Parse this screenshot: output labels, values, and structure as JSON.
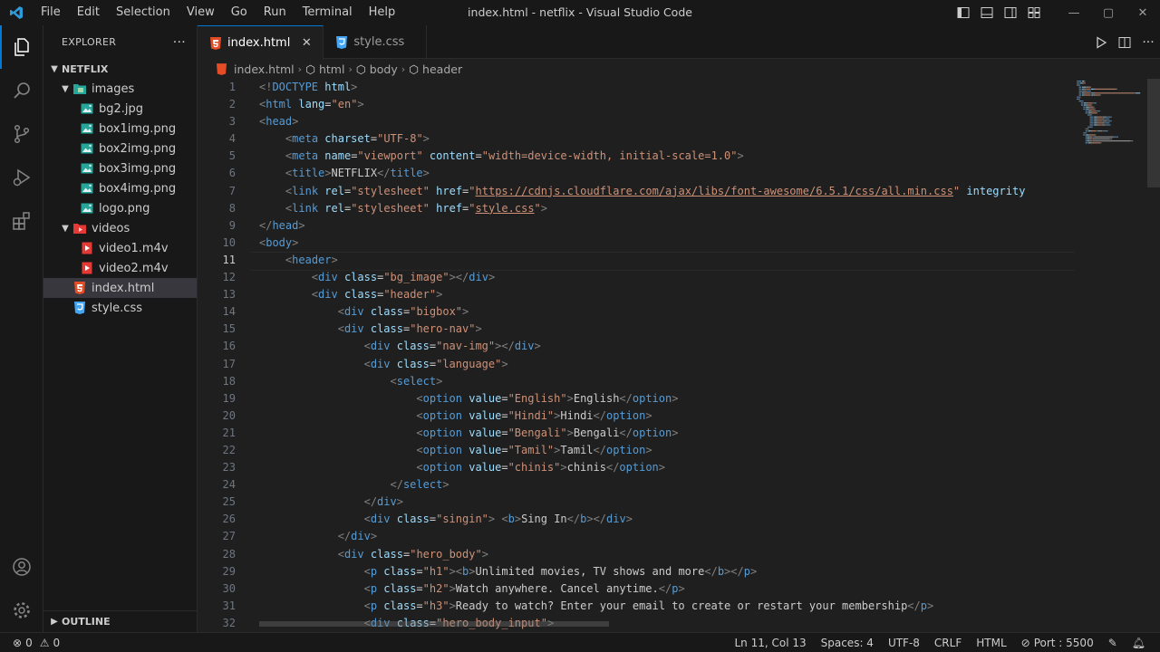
{
  "window": {
    "title": "index.html - netflix - Visual Studio Code"
  },
  "menu": [
    "File",
    "Edit",
    "Selection",
    "View",
    "Go",
    "Run",
    "Terminal",
    "Help"
  ],
  "sidebar": {
    "title": "EXPLORER",
    "more": "···",
    "root": "NETFLIX",
    "tree": [
      {
        "label": "images",
        "kind": "folder",
        "depth": 1
      },
      {
        "label": "bg2.jpg",
        "kind": "image",
        "depth": 2
      },
      {
        "label": "box1img.png",
        "kind": "image",
        "depth": 2
      },
      {
        "label": "box2img.png",
        "kind": "image",
        "depth": 2
      },
      {
        "label": "box3img.png",
        "kind": "image",
        "depth": 2
      },
      {
        "label": "box4img.png",
        "kind": "image",
        "depth": 2
      },
      {
        "label": "logo.png",
        "kind": "image",
        "depth": 2
      },
      {
        "label": "videos",
        "kind": "folder-video",
        "depth": 1
      },
      {
        "label": "video1.m4v",
        "kind": "video",
        "depth": 2
      },
      {
        "label": "video2.m4v",
        "kind": "video",
        "depth": 2
      },
      {
        "label": "index.html",
        "kind": "html",
        "depth": 1,
        "selected": true
      },
      {
        "label": "style.css",
        "kind": "css",
        "depth": 1
      }
    ],
    "outline": "OUTLINE"
  },
  "tabs": [
    {
      "label": "index.html",
      "active": true,
      "close": "✕"
    },
    {
      "label": "style.css",
      "active": false
    }
  ],
  "breadcrumb": [
    "index.html",
    "html",
    "body",
    "header"
  ],
  "editor": {
    "current_line": 11,
    "lines": [
      [
        [
          "tb",
          "<!"
        ],
        [
          "tg",
          "DOCTYPE"
        ],
        [
          "tx",
          " "
        ],
        [
          "at",
          "html"
        ],
        [
          "tb",
          ">"
        ]
      ],
      [
        [
          "tb",
          "<"
        ],
        [
          "tg",
          "html"
        ],
        [
          "tx",
          " "
        ],
        [
          "at",
          "lang"
        ],
        [
          "tx",
          "="
        ],
        [
          "vl",
          "\"en\""
        ],
        [
          "tb",
          ">"
        ]
      ],
      [
        [
          "tb",
          "<"
        ],
        [
          "tg",
          "head"
        ],
        [
          "tb",
          ">"
        ]
      ],
      [
        [
          "tx",
          "    "
        ],
        [
          "tb",
          "<"
        ],
        [
          "tg",
          "meta"
        ],
        [
          "tx",
          " "
        ],
        [
          "at",
          "charset"
        ],
        [
          "tx",
          "="
        ],
        [
          "vl",
          "\"UTF-8\""
        ],
        [
          "tb",
          ">"
        ]
      ],
      [
        [
          "tx",
          "    "
        ],
        [
          "tb",
          "<"
        ],
        [
          "tg",
          "meta"
        ],
        [
          "tx",
          " "
        ],
        [
          "at",
          "name"
        ],
        [
          "tx",
          "="
        ],
        [
          "vl",
          "\"viewport\""
        ],
        [
          "tx",
          " "
        ],
        [
          "at",
          "content"
        ],
        [
          "tx",
          "="
        ],
        [
          "vl",
          "\"width=device-width, initial-scale=1.0\""
        ],
        [
          "tb",
          ">"
        ]
      ],
      [
        [
          "tx",
          "    "
        ],
        [
          "tb",
          "<"
        ],
        [
          "tg",
          "title"
        ],
        [
          "tb",
          ">"
        ],
        [
          "tx",
          "NETFLIX"
        ],
        [
          "tb",
          "</"
        ],
        [
          "tg",
          "title"
        ],
        [
          "tb",
          ">"
        ]
      ],
      [
        [
          "tx",
          "    "
        ],
        [
          "tb",
          "<"
        ],
        [
          "tg",
          "link"
        ],
        [
          "tx",
          " "
        ],
        [
          "at",
          "rel"
        ],
        [
          "tx",
          "="
        ],
        [
          "vl",
          "\"stylesheet\""
        ],
        [
          "tx",
          " "
        ],
        [
          "at",
          "href"
        ],
        [
          "tx",
          "="
        ],
        [
          "vl",
          "\""
        ],
        [
          "lu",
          "https://cdnjs.cloudflare.com/ajax/libs/font-awesome/6.5.1/css/all.min.css"
        ],
        [
          "vl",
          "\""
        ],
        [
          "tx",
          " "
        ],
        [
          "at",
          "integrity"
        ]
      ],
      [
        [
          "tx",
          "    "
        ],
        [
          "tb",
          "<"
        ],
        [
          "tg",
          "link"
        ],
        [
          "tx",
          " "
        ],
        [
          "at",
          "rel"
        ],
        [
          "tx",
          "="
        ],
        [
          "vl",
          "\"stylesheet\""
        ],
        [
          "tx",
          " "
        ],
        [
          "at",
          "href"
        ],
        [
          "tx",
          "="
        ],
        [
          "vl",
          "\""
        ],
        [
          "lu",
          "style.css"
        ],
        [
          "vl",
          "\""
        ],
        [
          "tb",
          ">"
        ]
      ],
      [
        [
          "tb",
          "</"
        ],
        [
          "tg",
          "head"
        ],
        [
          "tb",
          ">"
        ]
      ],
      [
        [
          "tb",
          "<"
        ],
        [
          "tg",
          "body"
        ],
        [
          "tb",
          ">"
        ]
      ],
      [
        [
          "tx",
          "    "
        ],
        [
          "tb",
          "<"
        ],
        [
          "tg",
          "header"
        ],
        [
          "tb",
          ">"
        ]
      ],
      [
        [
          "tx",
          "        "
        ],
        [
          "tb",
          "<"
        ],
        [
          "tg",
          "div"
        ],
        [
          "tx",
          " "
        ],
        [
          "at",
          "class"
        ],
        [
          "tx",
          "="
        ],
        [
          "vl",
          "\"bg_image\""
        ],
        [
          "tb",
          "></"
        ],
        [
          "tg",
          "div"
        ],
        [
          "tb",
          ">"
        ]
      ],
      [
        [
          "tx",
          "        "
        ],
        [
          "tb",
          "<"
        ],
        [
          "tg",
          "div"
        ],
        [
          "tx",
          " "
        ],
        [
          "at",
          "class"
        ],
        [
          "tx",
          "="
        ],
        [
          "vl",
          "\"header\""
        ],
        [
          "tb",
          ">"
        ]
      ],
      [
        [
          "tx",
          "            "
        ],
        [
          "tb",
          "<"
        ],
        [
          "tg",
          "div"
        ],
        [
          "tx",
          " "
        ],
        [
          "at",
          "class"
        ],
        [
          "tx",
          "="
        ],
        [
          "vl",
          "\"bigbox\""
        ],
        [
          "tb",
          ">"
        ]
      ],
      [
        [
          "tx",
          "            "
        ],
        [
          "tb",
          "<"
        ],
        [
          "tg",
          "div"
        ],
        [
          "tx",
          " "
        ],
        [
          "at",
          "class"
        ],
        [
          "tx",
          "="
        ],
        [
          "vl",
          "\"hero-nav\""
        ],
        [
          "tb",
          ">"
        ]
      ],
      [
        [
          "tx",
          "                "
        ],
        [
          "tb",
          "<"
        ],
        [
          "tg",
          "div"
        ],
        [
          "tx",
          " "
        ],
        [
          "at",
          "class"
        ],
        [
          "tx",
          "="
        ],
        [
          "vl",
          "\"nav-img\""
        ],
        [
          "tb",
          "></"
        ],
        [
          "tg",
          "div"
        ],
        [
          "tb",
          ">"
        ]
      ],
      [
        [
          "tx",
          "                "
        ],
        [
          "tb",
          "<"
        ],
        [
          "tg",
          "div"
        ],
        [
          "tx",
          " "
        ],
        [
          "at",
          "class"
        ],
        [
          "tx",
          "="
        ],
        [
          "vl",
          "\"language\""
        ],
        [
          "tb",
          ">"
        ]
      ],
      [
        [
          "tx",
          "                    "
        ],
        [
          "tb",
          "<"
        ],
        [
          "tg",
          "select"
        ],
        [
          "tb",
          ">"
        ]
      ],
      [
        [
          "tx",
          "                        "
        ],
        [
          "tb",
          "<"
        ],
        [
          "tg",
          "option"
        ],
        [
          "tx",
          " "
        ],
        [
          "at",
          "value"
        ],
        [
          "tx",
          "="
        ],
        [
          "vl",
          "\"English\""
        ],
        [
          "tb",
          ">"
        ],
        [
          "tx",
          "English"
        ],
        [
          "tb",
          "</"
        ],
        [
          "tg",
          "option"
        ],
        [
          "tb",
          ">"
        ]
      ],
      [
        [
          "tx",
          "                        "
        ],
        [
          "tb",
          "<"
        ],
        [
          "tg",
          "option"
        ],
        [
          "tx",
          " "
        ],
        [
          "at",
          "value"
        ],
        [
          "tx",
          "="
        ],
        [
          "vl",
          "\"Hindi\""
        ],
        [
          "tb",
          ">"
        ],
        [
          "tx",
          "Hindi"
        ],
        [
          "tb",
          "</"
        ],
        [
          "tg",
          "option"
        ],
        [
          "tb",
          ">"
        ]
      ],
      [
        [
          "tx",
          "                        "
        ],
        [
          "tb",
          "<"
        ],
        [
          "tg",
          "option"
        ],
        [
          "tx",
          " "
        ],
        [
          "at",
          "value"
        ],
        [
          "tx",
          "="
        ],
        [
          "vl",
          "\"Bengali\""
        ],
        [
          "tb",
          ">"
        ],
        [
          "tx",
          "Bengali"
        ],
        [
          "tb",
          "</"
        ],
        [
          "tg",
          "option"
        ],
        [
          "tb",
          ">"
        ]
      ],
      [
        [
          "tx",
          "                        "
        ],
        [
          "tb",
          "<"
        ],
        [
          "tg",
          "option"
        ],
        [
          "tx",
          " "
        ],
        [
          "at",
          "value"
        ],
        [
          "tx",
          "="
        ],
        [
          "vl",
          "\"Tamil\""
        ],
        [
          "tb",
          ">"
        ],
        [
          "tx",
          "Tamil"
        ],
        [
          "tb",
          "</"
        ],
        [
          "tg",
          "option"
        ],
        [
          "tb",
          ">"
        ]
      ],
      [
        [
          "tx",
          "                        "
        ],
        [
          "tb",
          "<"
        ],
        [
          "tg",
          "option"
        ],
        [
          "tx",
          " "
        ],
        [
          "at",
          "value"
        ],
        [
          "tx",
          "="
        ],
        [
          "vl",
          "\"chinis\""
        ],
        [
          "tb",
          ">"
        ],
        [
          "tx",
          "chinis"
        ],
        [
          "tb",
          "</"
        ],
        [
          "tg",
          "option"
        ],
        [
          "tb",
          ">"
        ]
      ],
      [
        [
          "tx",
          "                    "
        ],
        [
          "tb",
          "</"
        ],
        [
          "tg",
          "select"
        ],
        [
          "tb",
          ">"
        ]
      ],
      [
        [
          "tx",
          "                "
        ],
        [
          "tb",
          "</"
        ],
        [
          "tg",
          "div"
        ],
        [
          "tb",
          ">"
        ]
      ],
      [
        [
          "tx",
          "                "
        ],
        [
          "tb",
          "<"
        ],
        [
          "tg",
          "div"
        ],
        [
          "tx",
          " "
        ],
        [
          "at",
          "class"
        ],
        [
          "tx",
          "="
        ],
        [
          "vl",
          "\"singin\""
        ],
        [
          "tb",
          ">"
        ],
        [
          "tx",
          " "
        ],
        [
          "tb",
          "<"
        ],
        [
          "tg",
          "b"
        ],
        [
          "tb",
          ">"
        ],
        [
          "tx",
          "Sing In"
        ],
        [
          "tb",
          "</"
        ],
        [
          "tg",
          "b"
        ],
        [
          "tb",
          "></"
        ],
        [
          "tg",
          "div"
        ],
        [
          "tb",
          ">"
        ]
      ],
      [
        [
          "tx",
          "            "
        ],
        [
          "tb",
          "</"
        ],
        [
          "tg",
          "div"
        ],
        [
          "tb",
          ">"
        ]
      ],
      [
        [
          "tx",
          "            "
        ],
        [
          "tb",
          "<"
        ],
        [
          "tg",
          "div"
        ],
        [
          "tx",
          " "
        ],
        [
          "at",
          "class"
        ],
        [
          "tx",
          "="
        ],
        [
          "vl",
          "\"hero_body\""
        ],
        [
          "tb",
          ">"
        ]
      ],
      [
        [
          "tx",
          "                "
        ],
        [
          "tb",
          "<"
        ],
        [
          "tg",
          "p"
        ],
        [
          "tx",
          " "
        ],
        [
          "at",
          "class"
        ],
        [
          "tx",
          "="
        ],
        [
          "vl",
          "\"h1\""
        ],
        [
          "tb",
          "><"
        ],
        [
          "tg",
          "b"
        ],
        [
          "tb",
          ">"
        ],
        [
          "tx",
          "Unlimited movies, TV shows and more"
        ],
        [
          "tb",
          "</"
        ],
        [
          "tg",
          "b"
        ],
        [
          "tb",
          "></"
        ],
        [
          "tg",
          "p"
        ],
        [
          "tb",
          ">"
        ]
      ],
      [
        [
          "tx",
          "                "
        ],
        [
          "tb",
          "<"
        ],
        [
          "tg",
          "p"
        ],
        [
          "tx",
          " "
        ],
        [
          "at",
          "class"
        ],
        [
          "tx",
          "="
        ],
        [
          "vl",
          "\"h2\""
        ],
        [
          "tb",
          ">"
        ],
        [
          "tx",
          "Watch anywhere. Cancel anytime."
        ],
        [
          "tb",
          "</"
        ],
        [
          "tg",
          "p"
        ],
        [
          "tb",
          ">"
        ]
      ],
      [
        [
          "tx",
          "                "
        ],
        [
          "tb",
          "<"
        ],
        [
          "tg",
          "p"
        ],
        [
          "tx",
          " "
        ],
        [
          "at",
          "class"
        ],
        [
          "tx",
          "="
        ],
        [
          "vl",
          "\"h3\""
        ],
        [
          "tb",
          ">"
        ],
        [
          "tx",
          "Ready to watch? Enter your email to create or restart your membership"
        ],
        [
          "tb",
          "</"
        ],
        [
          "tg",
          "p"
        ],
        [
          "tb",
          ">"
        ]
      ],
      [
        [
          "tx",
          "                "
        ],
        [
          "tb",
          "<"
        ],
        [
          "tg",
          "div"
        ],
        [
          "tx",
          " "
        ],
        [
          "at",
          "class"
        ],
        [
          "tx",
          "="
        ],
        [
          "vl",
          "\"hero_body_input\""
        ],
        [
          "tb",
          ">"
        ]
      ]
    ]
  },
  "statusbar": {
    "errors": "0",
    "warnings": "0",
    "position": "Ln 11, Col 13",
    "spaces": "Spaces: 4",
    "encoding": "UTF-8",
    "eol": "CRLF",
    "language": "HTML",
    "port": "Port : 5500"
  },
  "colors": {
    "accent": "#0078d4",
    "html_icon": "#e44d26",
    "css_icon": "#42a5f5",
    "image_icon": "#26a69a",
    "video_icon": "#e53935"
  }
}
